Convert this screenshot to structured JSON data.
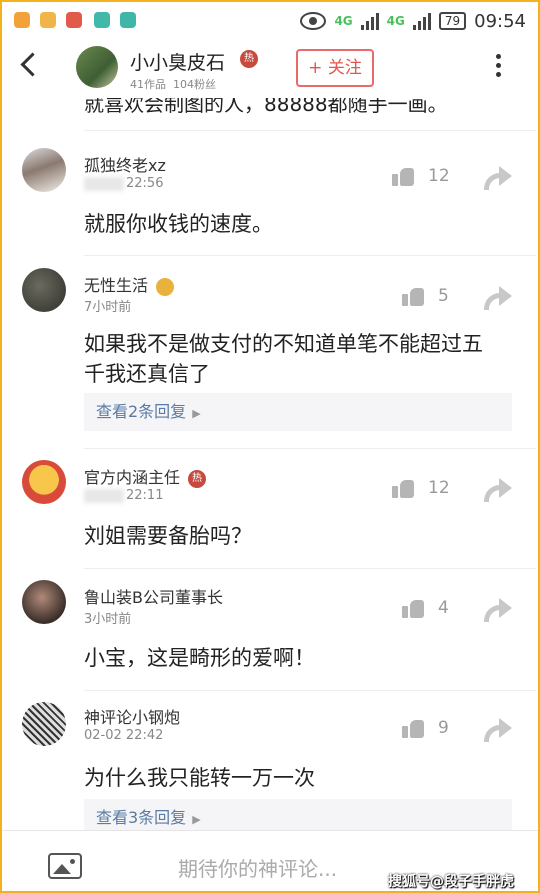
{
  "status": {
    "net1": "4G",
    "net2": "4G",
    "battery": "79",
    "time": "09:54"
  },
  "header": {
    "author": "小小臭皮石",
    "badge": "热",
    "works": "41作品",
    "fans": "104粉丝",
    "follow": "+ 关注"
  },
  "top_text": "就喜欢会制图的人，88888都随手一画。",
  "comments": [
    {
      "name": "孤独终老xz",
      "time": "22:56",
      "likes": "12",
      "text": "就服你收钱的速度。"
    },
    {
      "name": "无性生活",
      "time": "7小时前",
      "likes": "5",
      "text_line1": "如果我不是做支付的不知道单笔不能超过五",
      "text_line2": "千我还真信了",
      "replies": "查看2条回复"
    },
    {
      "name": "官方内涵主任",
      "badge": "热",
      "time": "22:11",
      "likes": "12",
      "text": "刘姐需要备胎吗？"
    },
    {
      "name": "鲁山装B公司董事长",
      "time": "3小时前",
      "likes": "4",
      "text": "小宝，这是畸形的爱啊！"
    },
    {
      "name": "神评论小钢炮",
      "time": "02-02 22:42",
      "likes": "9",
      "text": "为什么我只能转一万一次",
      "replies": "查看3条回复"
    }
  ],
  "bottom": {
    "placeholder": "期待你的神评论...",
    "watermark": "搜狐号@段子手胖虎"
  }
}
